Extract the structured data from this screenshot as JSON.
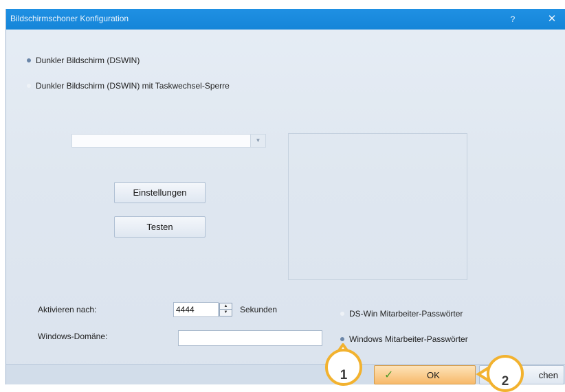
{
  "window": {
    "title": "Bildschirmschoner Konfiguration",
    "help_label": "?",
    "close_label": "✕"
  },
  "mode_options": [
    {
      "label": "Dunkler Bildschirm (DSWIN)",
      "checked": true
    },
    {
      "label": "Dunkler Bildschirm (DSWIN) mit Taskwechsel-Sperre",
      "checked": false
    }
  ],
  "screensaver_select": {
    "value": ""
  },
  "buttons": {
    "settings": "Einstellungen",
    "test": "Testen",
    "ok": "OK",
    "cancel_partial": "chen"
  },
  "activation": {
    "label": "Aktivieren nach:",
    "value": "4444",
    "unit": "Sekunden"
  },
  "domain": {
    "label": "Windows-Domäne:",
    "value": ""
  },
  "password_options": [
    {
      "label": "DS-Win Mitarbeiter-Passwörter",
      "checked": false
    },
    {
      "label": "Windows Mitarbeiter-Passwörter",
      "checked": true
    }
  ],
  "callouts": [
    "1",
    "2"
  ],
  "colors": {
    "titlebar": "#1585d8",
    "ok_button": "#f7b96a",
    "callout_ring": "#f2b22f"
  }
}
